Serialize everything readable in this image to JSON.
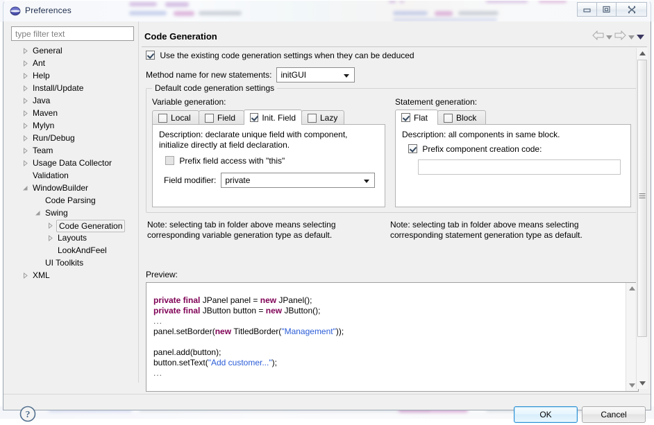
{
  "window": {
    "title": "Preferences",
    "icon": "preferences-sphere-icon",
    "controls": {
      "minimize": "Minimize",
      "restore": "Restore",
      "close": "Close"
    }
  },
  "sidebar": {
    "filter": {
      "placeholder": "type filter text",
      "value": ""
    },
    "items": [
      {
        "label": "General",
        "indent": 0,
        "twisty": "collapsed",
        "selected": false
      },
      {
        "label": "Ant",
        "indent": 0,
        "twisty": "collapsed",
        "selected": false
      },
      {
        "label": "Help",
        "indent": 0,
        "twisty": "collapsed",
        "selected": false
      },
      {
        "label": "Install/Update",
        "indent": 0,
        "twisty": "collapsed",
        "selected": false
      },
      {
        "label": "Java",
        "indent": 0,
        "twisty": "collapsed",
        "selected": false
      },
      {
        "label": "Maven",
        "indent": 0,
        "twisty": "collapsed",
        "selected": false
      },
      {
        "label": "Mylyn",
        "indent": 0,
        "twisty": "collapsed",
        "selected": false
      },
      {
        "label": "Run/Debug",
        "indent": 0,
        "twisty": "collapsed",
        "selected": false
      },
      {
        "label": "Team",
        "indent": 0,
        "twisty": "collapsed",
        "selected": false
      },
      {
        "label": "Usage Data Collector",
        "indent": 0,
        "twisty": "collapsed",
        "selected": false
      },
      {
        "label": "Validation",
        "indent": 0,
        "twisty": "none",
        "selected": false
      },
      {
        "label": "WindowBuilder",
        "indent": 0,
        "twisty": "expanded",
        "selected": false
      },
      {
        "label": "Code Parsing",
        "indent": 1,
        "twisty": "none",
        "selected": false
      },
      {
        "label": "Swing",
        "indent": 1,
        "twisty": "expanded",
        "selected": false
      },
      {
        "label": "Code Generation",
        "indent": 2,
        "twisty": "collapsed",
        "selected": true
      },
      {
        "label": "Layouts",
        "indent": 2,
        "twisty": "collapsed",
        "selected": false
      },
      {
        "label": "LookAndFeel",
        "indent": 2,
        "twisty": "none",
        "selected": false
      },
      {
        "label": "UI Toolkits",
        "indent": 1,
        "twisty": "none",
        "selected": false
      },
      {
        "label": "XML",
        "indent": 0,
        "twisty": "collapsed",
        "selected": false
      }
    ]
  },
  "page": {
    "title": "Code Generation",
    "nav": {
      "back_icon": "back-arrow-icon",
      "back_menu_icon": "chevron-down-icon",
      "forward_icon": "forward-arrow-icon",
      "forward_menu_icon": "chevron-down-icon",
      "view_menu_icon": "chevron-down-filled-icon"
    },
    "deduce_checkbox": {
      "label": "Use the existing code generation settings when they can be deduced",
      "checked": true
    },
    "method_name": {
      "label": "Method name for new statements:",
      "value": "initGUI"
    },
    "group": {
      "title": "Default code generation settings",
      "variable": {
        "label": "Variable generation:",
        "tabs": [
          {
            "label": "Local",
            "checked": false,
            "active": false
          },
          {
            "label": "Field",
            "checked": false,
            "active": false
          },
          {
            "label": "Init. Field",
            "checked": true,
            "active": true
          },
          {
            "label": "Lazy",
            "checked": false,
            "active": false
          }
        ],
        "description": "Description: declarate unique field with component, initialize directly at field declaration.",
        "prefix_this": {
          "label": "Prefix field access with \"this\"",
          "checked": false,
          "enabled": false
        },
        "field_modifier": {
          "label": "Field modifier:",
          "value": "private"
        }
      },
      "statement": {
        "label": "Statement generation:",
        "tabs": [
          {
            "label": "Flat",
            "checked": true,
            "active": true
          },
          {
            "label": "Block",
            "checked": false,
            "active": false
          }
        ],
        "description": "Description: all components in same block.",
        "prefix_creation": {
          "label": "Prefix component creation code:",
          "checked": true
        },
        "prefix_value": "",
        "prefix_placeholder": ""
      }
    },
    "notes": {
      "left": "Note: selecting tab in folder above means selecting corresponding variable generation type as default.",
      "right": "Note: selecting tab in folder above means selecting corresponding statement generation type as default."
    },
    "preview": {
      "label": "Preview:",
      "lines": [
        {
          "tokens": [
            {
              "t": "private final ",
              "c": "kw"
            },
            {
              "t": "JPanel panel = ",
              "c": ""
            },
            {
              "t": "new ",
              "c": "kw"
            },
            {
              "t": "JPanel();",
              "c": ""
            }
          ]
        },
        {
          "tokens": [
            {
              "t": "private final ",
              "c": "kw"
            },
            {
              "t": "JButton button = ",
              "c": ""
            },
            {
              "t": "new ",
              "c": "kw"
            },
            {
              "t": "JButton();",
              "c": ""
            }
          ]
        },
        {
          "tokens": [
            {
              "t": "...",
              "c": "dots"
            }
          ]
        },
        {
          "tokens": [
            {
              "t": "panel.setBorder(",
              "c": ""
            },
            {
              "t": "new ",
              "c": "kw"
            },
            {
              "t": "TitledBorder(",
              "c": ""
            },
            {
              "t": "\"Management\"",
              "c": "str"
            },
            {
              "t": "));",
              "c": ""
            }
          ]
        },
        {
          "tokens": [
            {
              "t": " ",
              "c": ""
            }
          ]
        },
        {
          "tokens": [
            {
              "t": "panel.add(button);",
              "c": ""
            }
          ]
        },
        {
          "tokens": [
            {
              "t": "button.setText(",
              "c": ""
            },
            {
              "t": "\"Add customer...\"",
              "c": "str"
            },
            {
              "t": ");",
              "c": ""
            }
          ]
        },
        {
          "tokens": [
            {
              "t": "...",
              "c": "dots"
            }
          ]
        }
      ]
    }
  },
  "footer": {
    "help_icon": "help-question-icon",
    "ok_label": "OK",
    "cancel_label": "Cancel"
  },
  "colors": {
    "accent_blue": "#2a8fd4",
    "keyword": "#7f0055",
    "string": "#2a5cd7",
    "dialog_bg": "#f0f0f0"
  }
}
